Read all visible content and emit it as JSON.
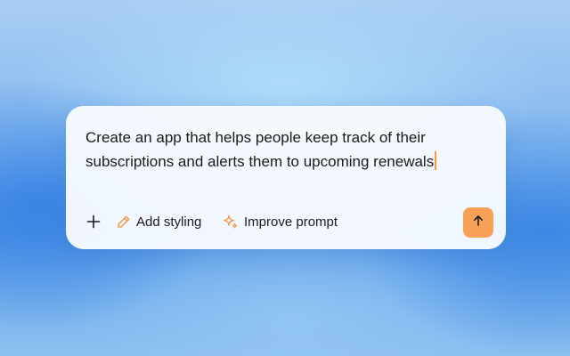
{
  "prompt": {
    "text": "Create an app that helps people keep track of their subscriptions and alerts them to upcoming renewals"
  },
  "toolbar": {
    "add_icon": "plus-icon",
    "add_styling_label": "Add styling",
    "add_styling_icon": "pencil-icon",
    "improve_prompt_label": "Improve prompt",
    "improve_prompt_icon": "sparkle-icon",
    "send_icon": "arrow-up-icon"
  },
  "colors": {
    "accent": "#f7a158",
    "caret": "#f19a4c",
    "card_background": "#f7fafe",
    "text": "#1b1b1f"
  }
}
